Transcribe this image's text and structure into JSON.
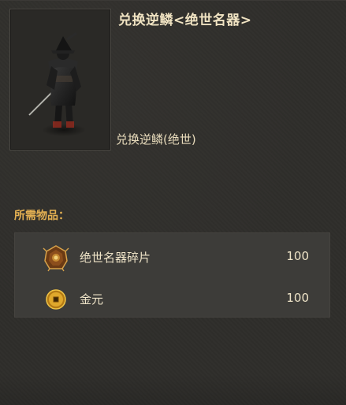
{
  "exchange": {
    "title": "兑换逆鳞<绝世名器>",
    "item_name": "兑换逆鳞(绝世)",
    "portrait_icon": "armored-warrior-with-sword"
  },
  "requirements": {
    "label": "所需物品：",
    "items": [
      {
        "name": "绝世名器碎片",
        "quantity": "100",
        "icon": "legendary-fragment-icon"
      },
      {
        "name": "金元",
        "quantity": "100",
        "icon": "gold-coin-icon"
      }
    ]
  },
  "colors": {
    "title": "#f0e3c2",
    "label_accent": "#e4b052",
    "panel_bg": "#2f2e2b",
    "req_box_bg": "#3d3c39"
  }
}
